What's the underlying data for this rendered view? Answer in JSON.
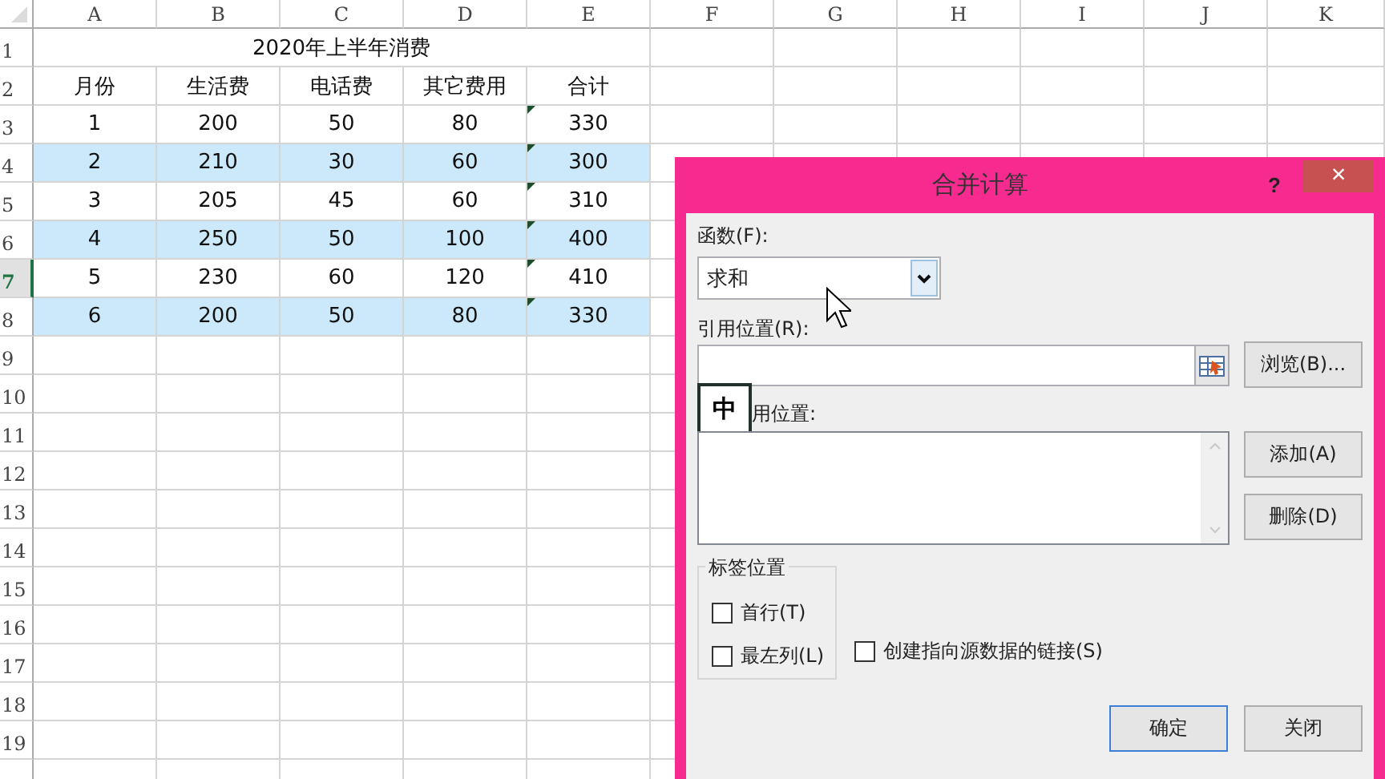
{
  "columns": [
    "A",
    "B",
    "C",
    "D",
    "E",
    "F",
    "G",
    "H",
    "I",
    "J",
    "K"
  ],
  "rows": [
    {
      "number": "1",
      "kind": "title",
      "selected": false,
      "title": "2020年上半年消费"
    },
    {
      "number": "2",
      "kind": "cells",
      "selected": false,
      "highlighted": false,
      "cells": [
        "月份",
        "生活费",
        "电话费",
        "其它费用",
        "合计"
      ]
    },
    {
      "number": "3",
      "kind": "cells",
      "selected": false,
      "highlighted": false,
      "error_mark": true,
      "cells": [
        "1",
        "200",
        "50",
        "80",
        "330"
      ]
    },
    {
      "number": "4",
      "kind": "cells",
      "selected": false,
      "highlighted": true,
      "error_mark": true,
      "cells": [
        "2",
        "210",
        "30",
        "60",
        "300"
      ]
    },
    {
      "number": "5",
      "kind": "cells",
      "selected": false,
      "highlighted": false,
      "error_mark": true,
      "cells": [
        "3",
        "205",
        "45",
        "60",
        "310"
      ]
    },
    {
      "number": "6",
      "kind": "cells",
      "selected": false,
      "highlighted": true,
      "error_mark": true,
      "cells": [
        "4",
        "250",
        "50",
        "100",
        "400"
      ]
    },
    {
      "number": "7",
      "kind": "cells",
      "selected": true,
      "highlighted": false,
      "error_mark": true,
      "cells": [
        "5",
        "230",
        "60",
        "120",
        "410"
      ]
    },
    {
      "number": "8",
      "kind": "cells",
      "selected": false,
      "highlighted": true,
      "error_mark": true,
      "cells": [
        "6",
        "200",
        "50",
        "80",
        "330"
      ]
    },
    {
      "number": "9",
      "kind": "empty",
      "selected": false
    },
    {
      "number": "10",
      "kind": "empty",
      "selected": false
    },
    {
      "number": "11",
      "kind": "empty",
      "selected": false
    },
    {
      "number": "12",
      "kind": "empty",
      "selected": false
    },
    {
      "number": "13",
      "kind": "empty",
      "selected": false
    },
    {
      "number": "14",
      "kind": "empty",
      "selected": false
    },
    {
      "number": "15",
      "kind": "empty",
      "selected": false
    },
    {
      "number": "16",
      "kind": "empty",
      "selected": false
    },
    {
      "number": "17",
      "kind": "empty",
      "selected": false
    },
    {
      "number": "18",
      "kind": "empty",
      "selected": false
    },
    {
      "number": "19",
      "kind": "empty",
      "selected": false
    }
  ],
  "dialog": {
    "title": "合并计算",
    "help": "?",
    "close": "×",
    "function_label": "函数(F):",
    "function_value": "求和",
    "reference_label": "引用位置(R):",
    "browse_button": "浏览(B)...",
    "all_references_label": "用位置:",
    "ime_indicator": "中",
    "add_button": "添加(A)",
    "delete_button": "删除(D)",
    "label_group": {
      "title": "标签位置",
      "options": [
        {
          "label": "首行(T)",
          "checked": false
        },
        {
          "label": "最左列(L)",
          "checked": false
        }
      ]
    },
    "link_option": {
      "label": "创建指向源数据的链接(S)",
      "checked": false
    },
    "buttons": [
      {
        "label": "确定",
        "default": true
      },
      {
        "label": "关闭",
        "default": false
      }
    ]
  }
}
